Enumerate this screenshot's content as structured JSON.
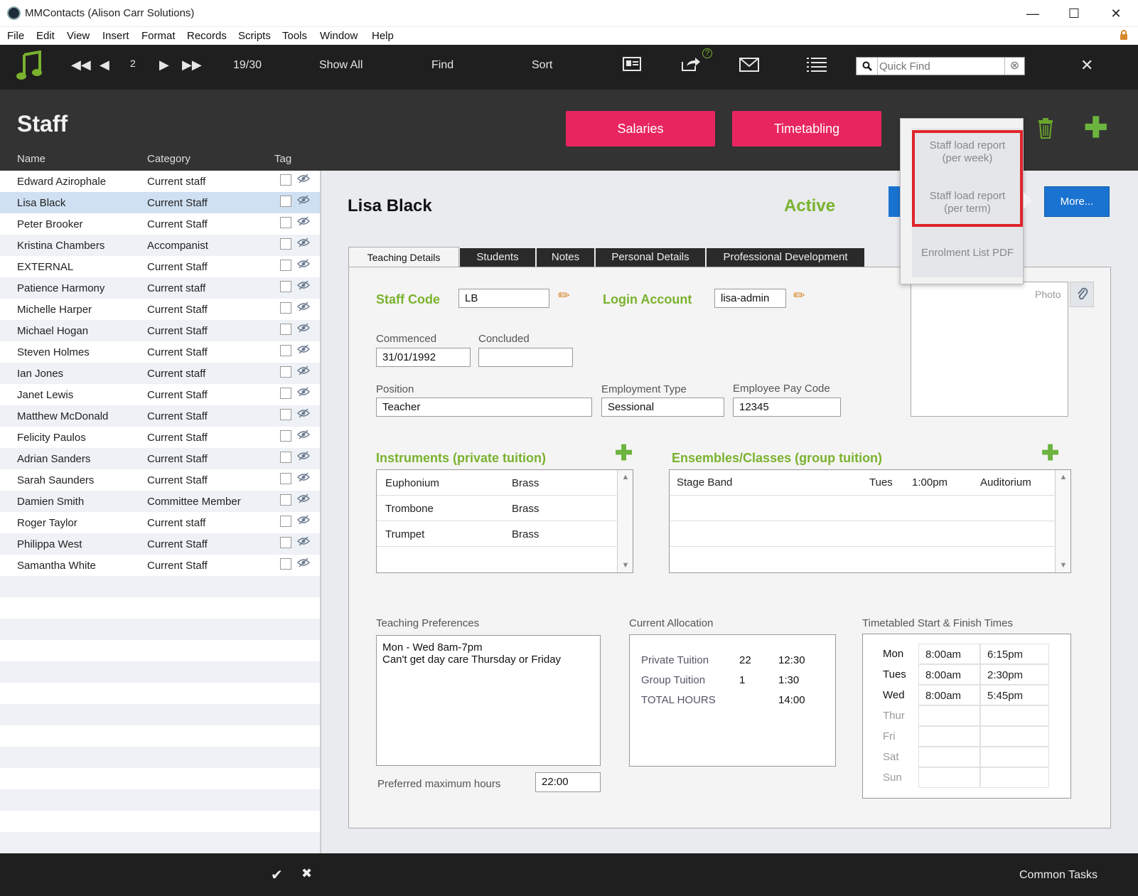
{
  "window": {
    "title": "MMContacts (Alison Carr Solutions)",
    "minimize": "—",
    "maximize": "☐",
    "close": "✕"
  },
  "menu": [
    "File",
    "Edit",
    "View",
    "Insert",
    "Format",
    "Records",
    "Scripts",
    "Tools",
    "Window",
    "Help"
  ],
  "toolbar": {
    "record_number": "2",
    "record_count": "19/30",
    "show_all": "Show All",
    "find": "Find",
    "sort": "Sort",
    "quick_find_placeholder": "Quick Find",
    "help_mark": "?"
  },
  "header": {
    "title": "Staff",
    "columns": {
      "name": "Name",
      "category": "Category",
      "tag": "Tag"
    },
    "salaries": "Salaries",
    "timetabling": "Timetabling"
  },
  "staff_list": [
    {
      "name": "Edward Azirophale",
      "category": "Current staff"
    },
    {
      "name": "Lisa Black",
      "category": "Current Staff",
      "selected": true
    },
    {
      "name": "Peter Brooker",
      "category": "Current Staff"
    },
    {
      "name": "Kristina Chambers",
      "category": "Accompanist"
    },
    {
      "name": " EXTERNAL",
      "category": "Current Staff"
    },
    {
      "name": "Patience Harmony",
      "category": "Current staff"
    },
    {
      "name": "Michelle Harper",
      "category": "Current Staff"
    },
    {
      "name": "Michael Hogan",
      "category": "Current Staff"
    },
    {
      "name": "Steven Holmes",
      "category": "Current Staff"
    },
    {
      "name": "Ian Jones",
      "category": "Current staff"
    },
    {
      "name": "Janet Lewis",
      "category": "Current Staff"
    },
    {
      "name": "Matthew McDonald",
      "category": "Current Staff"
    },
    {
      "name": "Felicity Paulos",
      "category": "Current Staff"
    },
    {
      "name": "Adrian Sanders",
      "category": "Current Staff"
    },
    {
      "name": "Sarah Saunders",
      "category": "Current Staff"
    },
    {
      "name": "Damien Smith",
      "category": "Committee Member"
    },
    {
      "name": "Roger Taylor",
      "category": "Current staff"
    },
    {
      "name": "Philippa West",
      "category": "Current Staff"
    },
    {
      "name": "Samantha White",
      "category": "Current Staff"
    }
  ],
  "record": {
    "name": "Lisa Black",
    "status": "Active",
    "more": "More..."
  },
  "tabs": [
    "Teaching Details",
    "Students",
    "Notes",
    "Personal Details",
    "Professional Development"
  ],
  "details": {
    "staff_code_label": "Staff Code",
    "staff_code": "LB",
    "login_label": "Login Account",
    "login": "lisa-admin",
    "commenced_label": "Commenced",
    "commenced": "31/01/1992",
    "concluded_label": "Concluded",
    "concluded": "",
    "position_label": "Position",
    "position": "Teacher",
    "employment_type_label": "Employment Type",
    "employment_type": "Sessional",
    "pay_code_label": "Employee Pay Code",
    "pay_code": "12345",
    "photo_label": "Photo"
  },
  "instruments": {
    "title": "Instruments (private tuition)",
    "rows": [
      {
        "instrument": "Euphonium",
        "family": "Brass"
      },
      {
        "instrument": "Trombone",
        "family": "Brass"
      },
      {
        "instrument": "Trumpet",
        "family": "Brass"
      }
    ]
  },
  "ensembles": {
    "title": "Ensembles/Classes (group tuition)",
    "rows": [
      {
        "name": "Stage Band",
        "day": "Tues",
        "time": "1:00pm",
        "venue": "Auditorium"
      }
    ]
  },
  "preferences": {
    "label": "Teaching Preferences",
    "text_line1": "Mon - Wed 8am-7pm",
    "text_line2": "Can't get day care Thursday or Friday",
    "max_hours_label": "Preferred maximum hours",
    "max_hours": "22:00"
  },
  "allocation": {
    "label": "Current Allocation",
    "rows": [
      {
        "label": "Private Tuition",
        "count": "22",
        "hours": "12:30"
      },
      {
        "label": "Group Tuition",
        "count": "1",
        "hours": "1:30"
      },
      {
        "label": "TOTAL HOURS",
        "count": "",
        "hours": "14:00"
      }
    ]
  },
  "times": {
    "label": "Timetabled Start & Finish Times",
    "rows": [
      {
        "day": "Mon",
        "start": "8:00am",
        "finish": "6:15pm"
      },
      {
        "day": "Tues",
        "start": "8:00am",
        "finish": "2:30pm"
      },
      {
        "day": "Wed",
        "start": "8:00am",
        "finish": "5:45pm"
      },
      {
        "day": "Thur",
        "start": "",
        "finish": ""
      },
      {
        "day": "Fri",
        "start": "",
        "finish": ""
      },
      {
        "day": "Sat",
        "start": "",
        "finish": ""
      },
      {
        "day": "Sun",
        "start": "",
        "finish": ""
      }
    ]
  },
  "dropdown": {
    "item1_line1": "Staff load report",
    "item1_line2": "(per week)",
    "item2_line1": "Staff load report",
    "item2_line2": "(per term)",
    "item3": "Enrolment List PDF"
  },
  "footer": {
    "common_tasks": "Common Tasks"
  },
  "colors": {
    "accent_green": "#7ab22e",
    "pink": "#e8255f",
    "blue": "#1a73d1",
    "highlight_red": "#e0242b"
  }
}
